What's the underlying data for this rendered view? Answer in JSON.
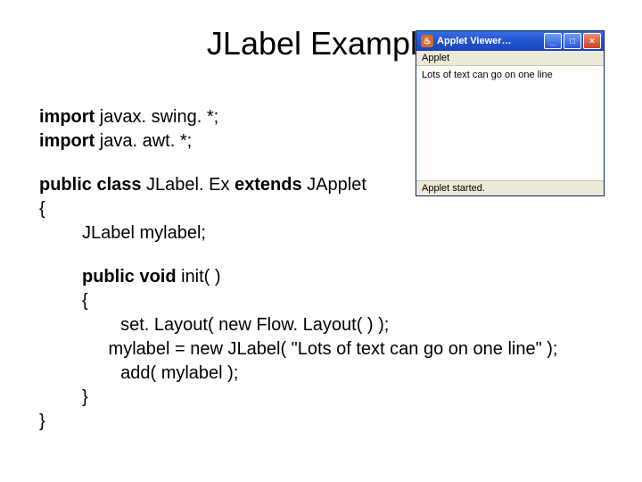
{
  "title": "JLabel Example",
  "code": {
    "import1_kw": "import",
    "import1_rest": " javax. swing. *;",
    "import2_kw": "import",
    "import2_rest": " java. awt. *;",
    "classdecl_kwpc": "public class",
    "classdecl_name": " JLabel. Ex ",
    "classdecl_ext": "extends",
    "classdecl_rest": " JApplet",
    "brace_open_class": "{",
    "field": "JLabel mylabel;",
    "method_kw": "public void",
    "method_name": " init( )",
    "brace_open_m": "{",
    "line_setlayout": "  set. Layout( new Flow. Layout( ) );",
    "line_mylabel": " mylabel = new JLabel( \"Lots of text can go on one line\" );",
    "line_add": "  add( mylabel );",
    "brace_close_m": "}",
    "brace_close_class": "}"
  },
  "applet": {
    "java_glyph": "♨",
    "title": "Applet Viewer…",
    "btn_min": "_",
    "btn_max": "□",
    "btn_close": "×",
    "menu": "Applet",
    "content": "Lots of text can go on one line",
    "status": "Applet started."
  }
}
